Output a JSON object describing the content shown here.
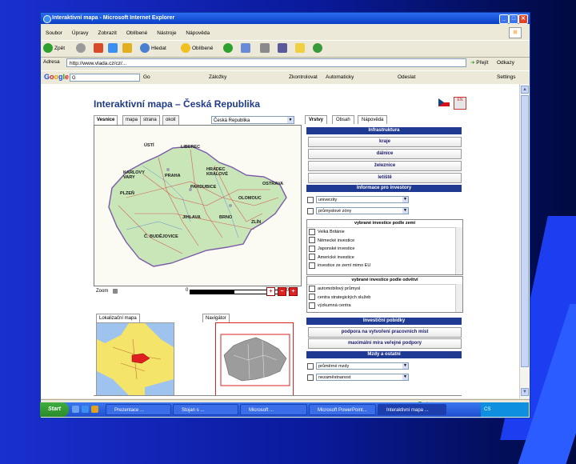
{
  "window": {
    "title": "Interaktivní mapa - Microsoft Internet Explorer",
    "min": "_",
    "max": "□",
    "close": "✕"
  },
  "menu": [
    "Soubor",
    "Úpravy",
    "Zobrazit",
    "Oblíbené",
    "Nástroje",
    "Nápověda"
  ],
  "toolbar": {
    "back": "Zpět",
    "search": "Hledat",
    "favorites": "Oblíbené"
  },
  "address": {
    "label": "Adresa",
    "value": "http://www.vlada.cz/cz/...",
    "go": "Přejít",
    "links": "Odkazy"
  },
  "google": {
    "logo": [
      "G",
      "o",
      "o",
      "g",
      "l",
      "e"
    ],
    "search_value": "G",
    "items": [
      "Go",
      "Záložky",
      "Zkontrolovat",
      "Automaticky",
      "Odeslat",
      "Settings"
    ]
  },
  "page": {
    "title": "Interaktivní mapa – Česká Republika",
    "flag_other_label": "EN"
  },
  "map": {
    "tabs": [
      "Vesnice",
      "mapa",
      "strana",
      "okolí"
    ],
    "region_select": "Česká Republika",
    "cities": [
      {
        "name": "ÚSTÍ"
      },
      {
        "name": "LIBEREC"
      },
      {
        "name": "KARLOVY VARY"
      },
      {
        "name": "PRAHA"
      },
      {
        "name": "HRADEC KRÁLOVÉ"
      },
      {
        "name": "PARDUBICE"
      },
      {
        "name": "OSTRAVA"
      },
      {
        "name": "PLZEŇ"
      },
      {
        "name": "OLOMOUC"
      },
      {
        "name": "JIHLAVA"
      },
      {
        "name": "BRNO"
      },
      {
        "name": "ZLÍN"
      },
      {
        "name": "Č. BUDĚJOVICE"
      }
    ],
    "zoom_label": "Zoom",
    "scale_start": "0",
    "scale_end": "200km",
    "zoom_buttons": [
      "+",
      "−",
      "+"
    ]
  },
  "minimaps": {
    "location_tab": "Lokalizační mapa",
    "navigator_tab": "Navigátor"
  },
  "panel": {
    "tabs": [
      "Vrstvy",
      "Obsah",
      "Nápověda"
    ],
    "infra_header": "Infrastruktura",
    "infra_buttons": [
      "kraje",
      "dálnice",
      "železnice",
      "letiště"
    ],
    "investor_header": "Informace pro investory",
    "investor_selects": [
      "univerzity",
      "průmyslové zóny"
    ],
    "list1_header": "vybrané investice podle zemí",
    "list1_items": [
      "Velká Británie",
      "Německé investice",
      "Japonské investice",
      "Americké investice",
      "investice ze zemí mimo EU"
    ],
    "list2_header": "vybrané investice podle odvětví",
    "list2_items": [
      "automobilový průmysl",
      "centra strategických služeb",
      "výzkumná centra"
    ],
    "support_header": "Investiční pobídky",
    "support_buttons": [
      "podpora na vytvoření pracovních míst",
      "maximální míra veřejné podpory"
    ],
    "misc_header": "Mzdy a ostatní",
    "misc_selects": [
      "průměrné mzdy",
      "nezaměstnanost"
    ]
  },
  "status": {
    "left": "",
    "right": "Internet"
  },
  "taskbar": {
    "start": "Start",
    "tasks": [
      "Prezentace ...",
      "Stojan s ...",
      "Microsoft ...",
      "Microsoft PowerPoint...",
      "Interaktivní mapa ..."
    ],
    "tray": "CS"
  },
  "colors": {
    "header_blue": "#1f3a93",
    "title_blue": "#203a8a",
    "xp_title": "#0a3fc4"
  }
}
